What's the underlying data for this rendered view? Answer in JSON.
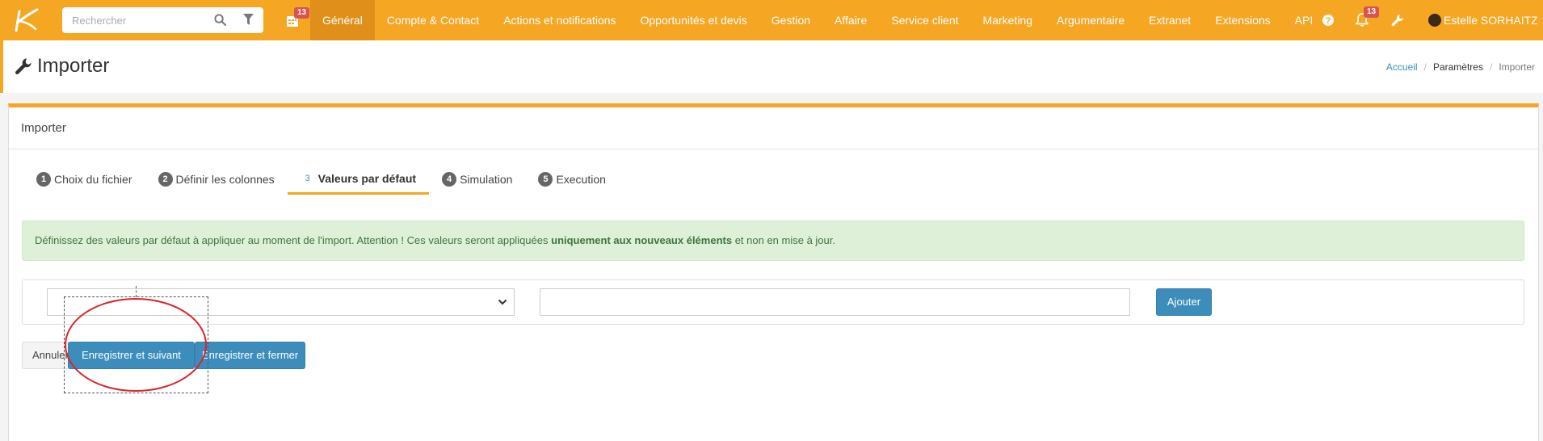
{
  "app": {
    "logo": "app-logo"
  },
  "search": {
    "placeholder": "Rechercher"
  },
  "calendar_badge": "13",
  "nav": [
    {
      "label": "Général",
      "active": true
    },
    {
      "label": "Compte & Contact"
    },
    {
      "label": "Actions et notifications"
    },
    {
      "label": "Opportunités et devis"
    },
    {
      "label": "Gestion"
    },
    {
      "label": "Affaire"
    },
    {
      "label": "Service client"
    },
    {
      "label": "Marketing"
    },
    {
      "label": "Argumentaire"
    },
    {
      "label": "Extranet"
    },
    {
      "label": "Extensions"
    },
    {
      "label": "API"
    }
  ],
  "notifications_badge": "13",
  "user": {
    "name": "Estelle SORHAITZ"
  },
  "page": {
    "title": "Importer"
  },
  "breadcrumb": {
    "home": "Accueil",
    "parent": "Paramètres",
    "current": "Importer"
  },
  "panel": {
    "title": "Importer"
  },
  "steps": [
    {
      "num": "1",
      "label": "Choix du fichier"
    },
    {
      "num": "2",
      "label": "Définir les colonnes"
    },
    {
      "num": "3",
      "label": "Valeurs par défaut",
      "active": true
    },
    {
      "num": "4",
      "label": "Simulation"
    },
    {
      "num": "5",
      "label": "Execution"
    }
  ],
  "alert": {
    "before": "Définissez des valeurs par défaut à appliquer au moment de l'import. Attention ! Ces valeurs seront appliquées ",
    "strong": "uniquement aux nouveaux éléments",
    "after": " et non en mise à jour."
  },
  "form": {
    "select_value": "",
    "text_value": "",
    "add_label": "Ajouter"
  },
  "actions": {
    "cancel": "Annuler",
    "save_next": "Enregistrer et suivant",
    "save_close": "Enregistrer et fermer"
  },
  "colors": {
    "accent": "#f5a623",
    "primary": "#3c8dbc",
    "alert_bg": "#dff0d8",
    "annotation": "#d9262b"
  }
}
